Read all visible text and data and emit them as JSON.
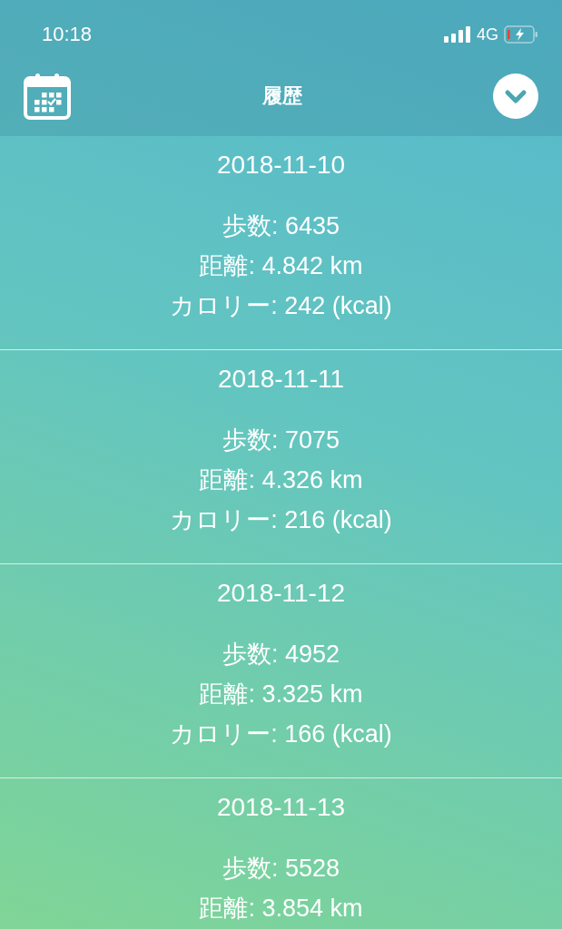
{
  "status_bar": {
    "time": "10:18",
    "network": "4G"
  },
  "header": {
    "title": "履歴"
  },
  "entries": [
    {
      "date": "2018-11-10",
      "lines": [
        "歩数: 6435",
        "距離: 4.842 km",
        "カロリー: 242 (kcal)"
      ]
    },
    {
      "date": "2018-11-11",
      "lines": [
        "歩数: 7075",
        "距離: 4.326 km",
        "カロリー: 216 (kcal)"
      ]
    },
    {
      "date": "2018-11-12",
      "lines": [
        "歩数: 4952",
        "距離: 3.325 km",
        "カロリー: 166 (kcal)"
      ]
    },
    {
      "date": "2018-11-13",
      "lines": [
        "歩数: 5528",
        "距離: 3.854 km"
      ]
    }
  ]
}
